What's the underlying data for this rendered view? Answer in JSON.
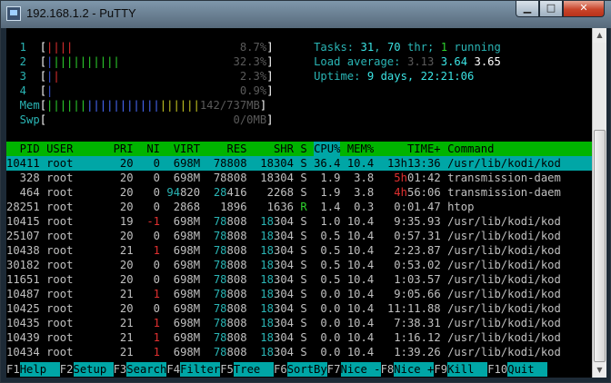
{
  "window": {
    "title": "192.168.1.2 - PuTTY",
    "buttons": {
      "minimize": "▁",
      "maximize": "□",
      "close": "✕"
    }
  },
  "meters": {
    "cpu1": {
      "label": "1",
      "bar_red": "",
      "bar_green": "||||",
      "value": "8.7%"
    },
    "cpu2": {
      "label": "2",
      "bar_red": "|",
      "bar_green": "||||||||||",
      "value": "32.3%"
    },
    "cpu3": {
      "label": "3",
      "bar_red": "|",
      "bar_green": "|",
      "value": "2.3%"
    },
    "cpu4": {
      "label": "4",
      "bar_red": "|",
      "bar_green": "",
      "value": "0.9%"
    },
    "mem": {
      "label": "Mem",
      "bar_green": "||||||",
      "bar_blue": "|||||||||||",
      "bar_yellow": "||||||",
      "value": "142/737MB"
    },
    "swp": {
      "label": "Swp",
      "value": "0/0MB"
    }
  },
  "summary": {
    "tasks_label": "Tasks: ",
    "tasks_count": "31",
    "thr_sep": ", ",
    "thr_count": "70",
    "thr_label": " thr; ",
    "running_count": "1",
    "running_label": " running",
    "load_label": "Load average: ",
    "load1": "3.13",
    "load5": "3.64",
    "load15": "3.65",
    "uptime_label": "Uptime: ",
    "uptime_value": "9 days, 22:21:06"
  },
  "table": {
    "columns": [
      "PID",
      "USER",
      "PRI",
      "NI",
      "VIRT",
      "RES",
      "SHR",
      "S",
      "CPU%",
      "MEM%",
      "TIME+",
      "Command"
    ],
    "selected_index": 0,
    "rows": [
      {
        "pid": "10411",
        "user": "root",
        "pri": "20",
        "ni": "0",
        "virt_hi": "",
        "virt_lo": "698M",
        "res_hi": "",
        "res_lo": "78808",
        "shr_hi": "",
        "shr_lo": "18304",
        "s": "S",
        "cpu": "36.4",
        "mem": "10.4",
        "time_hi": "",
        "time_lo": "13h13:36",
        "cmd": "/usr/lib/kodi/kod"
      },
      {
        "pid": "328",
        "user": "root",
        "pri": "20",
        "ni": "0",
        "virt_hi": "",
        "virt_lo": "698M",
        "res_hi": "",
        "res_lo": "78808",
        "shr_hi": "",
        "shr_lo": "18304",
        "s": "S",
        "cpu": "1.9",
        "mem": "3.8",
        "time_hi": "5h",
        "time_lo": "01:42",
        "cmd": "transmission-daem"
      },
      {
        "pid": "464",
        "user": "root",
        "pri": "20",
        "ni": "0",
        "virt_hi": "94",
        "virt_lo": "820",
        "res_hi": "28",
        "res_lo": "416",
        "shr_hi": "",
        "shr_lo": "2268",
        "s": "S",
        "cpu": "1.9",
        "mem": "3.8",
        "time_hi": "4h",
        "time_lo": "56:06",
        "cmd": "transmission-daem"
      },
      {
        "pid": "28251",
        "user": "root",
        "pri": "20",
        "ni": "0",
        "virt_hi": "",
        "virt_lo": "2868",
        "res_hi": "",
        "res_lo": "1896",
        "shr_hi": "",
        "shr_lo": "1636",
        "s": "R",
        "cpu": "1.4",
        "mem": "0.3",
        "time_hi": "",
        "time_lo": "0:01.47",
        "cmd": "htop"
      },
      {
        "pid": "10415",
        "user": "root",
        "pri": "19",
        "ni": "-1",
        "virt_hi": "",
        "virt_lo": "698M",
        "res_hi": "78",
        "res_lo": "808",
        "shr_hi": "18",
        "shr_lo": "304",
        "s": "S",
        "cpu": "1.0",
        "mem": "10.4",
        "time_hi": "",
        "time_lo": "9:35.93",
        "cmd": "/usr/lib/kodi/kod"
      },
      {
        "pid": "25107",
        "user": "root",
        "pri": "20",
        "ni": "0",
        "virt_hi": "",
        "virt_lo": "698M",
        "res_hi": "78",
        "res_lo": "808",
        "shr_hi": "18",
        "shr_lo": "304",
        "s": "S",
        "cpu": "0.5",
        "mem": "10.4",
        "time_hi": "",
        "time_lo": "0:57.31",
        "cmd": "/usr/lib/kodi/kod"
      },
      {
        "pid": "10438",
        "user": "root",
        "pri": "21",
        "ni": "1",
        "virt_hi": "",
        "virt_lo": "698M",
        "res_hi": "78",
        "res_lo": "808",
        "shr_hi": "18",
        "shr_lo": "304",
        "s": "S",
        "cpu": "0.5",
        "mem": "10.4",
        "time_hi": "",
        "time_lo": "2:23.87",
        "cmd": "/usr/lib/kodi/kod"
      },
      {
        "pid": "30182",
        "user": "root",
        "pri": "20",
        "ni": "0",
        "virt_hi": "",
        "virt_lo": "698M",
        "res_hi": "78",
        "res_lo": "808",
        "shr_hi": "18",
        "shr_lo": "304",
        "s": "S",
        "cpu": "0.5",
        "mem": "10.4",
        "time_hi": "",
        "time_lo": "0:53.02",
        "cmd": "/usr/lib/kodi/kod"
      },
      {
        "pid": "11651",
        "user": "root",
        "pri": "20",
        "ni": "0",
        "virt_hi": "",
        "virt_lo": "698M",
        "res_hi": "78",
        "res_lo": "808",
        "shr_hi": "18",
        "shr_lo": "304",
        "s": "S",
        "cpu": "0.5",
        "mem": "10.4",
        "time_hi": "",
        "time_lo": "1:03.57",
        "cmd": "/usr/lib/kodi/kod"
      },
      {
        "pid": "10487",
        "user": "root",
        "pri": "21",
        "ni": "1",
        "virt_hi": "",
        "virt_lo": "698M",
        "res_hi": "78",
        "res_lo": "808",
        "shr_hi": "18",
        "shr_lo": "304",
        "s": "S",
        "cpu": "0.0",
        "mem": "10.4",
        "time_hi": "",
        "time_lo": "9:05.66",
        "cmd": "/usr/lib/kodi/kod"
      },
      {
        "pid": "10425",
        "user": "root",
        "pri": "20",
        "ni": "0",
        "virt_hi": "",
        "virt_lo": "698M",
        "res_hi": "78",
        "res_lo": "808",
        "shr_hi": "18",
        "shr_lo": "304",
        "s": "S",
        "cpu": "0.0",
        "mem": "10.4",
        "time_hi": "",
        "time_lo": "11:11.88",
        "cmd": "/usr/lib/kodi/kod"
      },
      {
        "pid": "10435",
        "user": "root",
        "pri": "21",
        "ni": "1",
        "virt_hi": "",
        "virt_lo": "698M",
        "res_hi": "78",
        "res_lo": "808",
        "shr_hi": "18",
        "shr_lo": "304",
        "s": "S",
        "cpu": "0.0",
        "mem": "10.4",
        "time_hi": "",
        "time_lo": "7:38.31",
        "cmd": "/usr/lib/kodi/kod"
      },
      {
        "pid": "10439",
        "user": "root",
        "pri": "21",
        "ni": "1",
        "virt_hi": "",
        "virt_lo": "698M",
        "res_hi": "78",
        "res_lo": "808",
        "shr_hi": "18",
        "shr_lo": "304",
        "s": "S",
        "cpu": "0.0",
        "mem": "10.4",
        "time_hi": "",
        "time_lo": "1:16.12",
        "cmd": "/usr/lib/kodi/kod"
      },
      {
        "pid": "10434",
        "user": "root",
        "pri": "21",
        "ni": "1",
        "virt_hi": "",
        "virt_lo": "698M",
        "res_hi": "78",
        "res_lo": "808",
        "shr_hi": "18",
        "shr_lo": "304",
        "s": "S",
        "cpu": "0.0",
        "mem": "10.4",
        "time_hi": "",
        "time_lo": "1:39.26",
        "cmd": "/usr/lib/kodi/kod"
      }
    ]
  },
  "function_keys": [
    {
      "key": "F1",
      "label": "Help  "
    },
    {
      "key": "F2",
      "label": "Setup "
    },
    {
      "key": "F3",
      "label": "Search"
    },
    {
      "key": "F4",
      "label": "Filter"
    },
    {
      "key": "F5",
      "label": "Tree  "
    },
    {
      "key": "F6",
      "label": "SortBy"
    },
    {
      "key": "F7",
      "label": "Nice -"
    },
    {
      "key": "F8",
      "label": "Nice +"
    },
    {
      "key": "F9",
      "label": "Kill  "
    },
    {
      "key": "F10",
      "label": "Quit  "
    }
  ]
}
